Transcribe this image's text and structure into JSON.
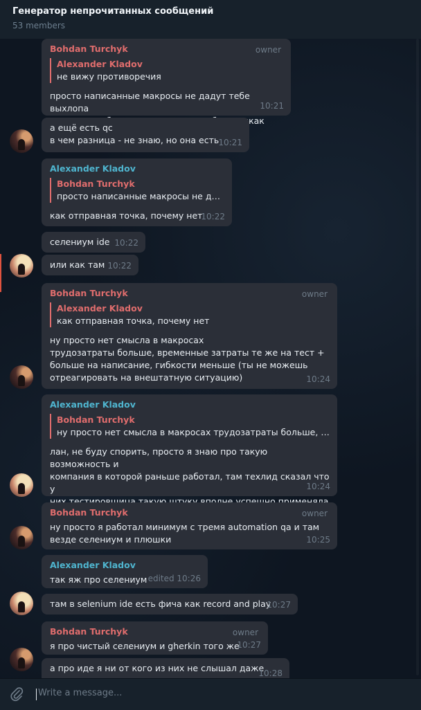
{
  "header": {
    "title": "Генератор непрочитанных сообщений",
    "members": "53 members"
  },
  "messages": {
    "m1": {
      "name": "Bohdan Turchyk",
      "badge": "owner",
      "reply_name": "Alexander Kladov",
      "reply_text": "не вижу противоречия",
      "text": "просто написанные макросы не дадут тебе выхлопа\nтак что там без селениумов и подобных никак",
      "time": "10:21"
    },
    "m2": {
      "text": "а ещё есть qc\nв чем разница - не знаю, но она есть",
      "time": "10:21"
    },
    "m3": {
      "name": "Alexander Kladov",
      "reply_name": "Bohdan Turchyk",
      "reply_text": "просто написанные макросы не дад...",
      "text": "как отправная точка, почему нет",
      "time": "10:22"
    },
    "m4": {
      "text": "селениум ide",
      "time": "10:22"
    },
    "m5": {
      "text": "или как там",
      "time": "10:22"
    },
    "m6": {
      "name": "Bohdan Turchyk",
      "badge": "owner",
      "reply_name": "Alexander Kladov",
      "reply_text": "как отправная точка, почему нет",
      "text": "ну просто нет смысла в макросах\nтрудозатраты больше, временные затраты те же на тест +\nбольше на написание, гибкости меньше (ты не можешь\nотреагировать на внештатную ситуацию)",
      "time": "10:24"
    },
    "m7": {
      "name": "Alexander Kladov",
      "reply_name": "Bohdan Turchyk",
      "reply_text": "ну просто нет смысла в макросах трудозатраты больше, вре...",
      "text": "лан, не буду спорить, просто я знаю про такую возможность и\nкомпания в которой раньше работал, там техлид сказал что у\nних тестировщица такую штуку вполне успешно применяла",
      "time": "10:24"
    },
    "m8": {
      "name": "Bohdan Turchyk",
      "badge": "owner",
      "text": "ну просто я работал минимум с тремя automation qa и там\nвезде селениум и плюшки",
      "time": "10:25"
    },
    "m9": {
      "name": "Alexander Kladov",
      "text": "так яж про селениум",
      "time": "edited 10:26"
    },
    "m10": {
      "text": "там в selenium ide есть фича как record and play",
      "time": "10:27"
    },
    "m11": {
      "name": "Bohdan Turchyk",
      "badge": "owner",
      "text": "я про чистый селениум и gherkin того же",
      "time": "10:27"
    },
    "m12": {
      "text": "а про иде я ни от кого из них не слышал даже",
      "time": "10:28"
    }
  },
  "composer": {
    "placeholder": "Write a message..."
  },
  "icons": {
    "attach": "paperclip-icon"
  }
}
